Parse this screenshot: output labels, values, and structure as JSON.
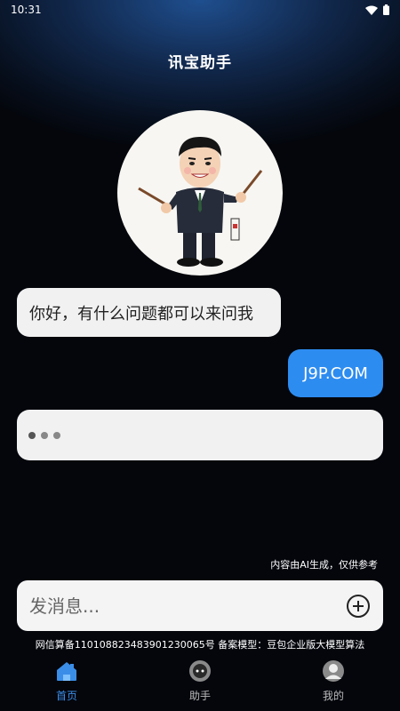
{
  "status_bar": {
    "time": "10:31",
    "icons": [
      "wifi-icon",
      "battery-icon"
    ]
  },
  "header": {
    "title": "讯宝助手"
  },
  "assistant": {
    "avatar_icon": "assistant-avatar-icon"
  },
  "messages": [
    {
      "role": "bot",
      "text": "你好，有什么问题都可以来问我"
    },
    {
      "role": "user",
      "text": "J9P.COM"
    },
    {
      "role": "bot",
      "typing": true
    }
  ],
  "ai_note": "内容由AI生成，仅供参考",
  "input": {
    "placeholder": "发消息...",
    "value": "",
    "add_icon": "plus-circle-icon"
  },
  "filing": "网信算备110108823483901230065号 备案模型：豆包企业版大模型算法",
  "tabs": [
    {
      "label": "首页",
      "icon": "home-icon",
      "active": true
    },
    {
      "label": "助手",
      "icon": "assistant-icon",
      "active": false
    },
    {
      "label": "我的",
      "icon": "profile-icon",
      "active": false
    }
  ],
  "colors": {
    "accent": "#2d8cf0",
    "active_tab": "#3b8ee8",
    "background": "#04060c",
    "bubble": "#f1f1f1"
  }
}
